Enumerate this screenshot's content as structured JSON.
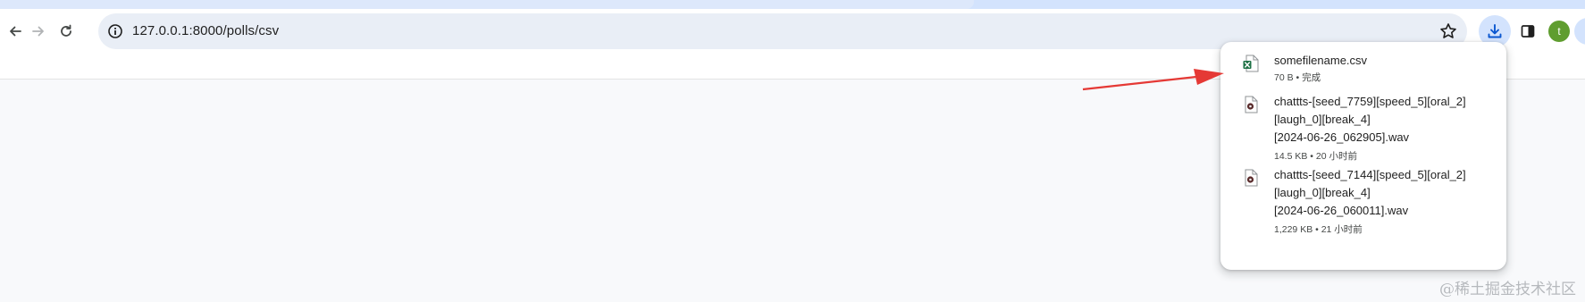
{
  "browser": {
    "url": "127.0.0.1:8000/polls/csv",
    "avatar_letter": "t"
  },
  "colors": {
    "accent": "#0b57d0",
    "toolbar_bg": "#ffffff",
    "omnibox_bg": "#e9eef6",
    "arrow": "#e53935",
    "excel_green": "#1e7145"
  },
  "downloads": {
    "items": [
      {
        "name": "somefilename.csv",
        "meta": "70 B • 完成",
        "icon": "excel-file-icon"
      },
      {
        "name": "chattts-[seed_7759][speed_5][oral_2][laugh_0][break_4][2024-06-26_062905].wav",
        "line1": "chattts-[seed_7759][speed_5][oral_2]",
        "line2": "[laugh_0][break_4]",
        "line3": "[2024-06-26_062905].wav",
        "meta": "14.5 KB • 20 小时前",
        "icon": "audio-file-icon"
      },
      {
        "name": "chattts-[seed_7144][speed_5][oral_2][laugh_0][break_4][2024-06-26_060011].wav",
        "line1": "chattts-[seed_7144][speed_5][oral_2]",
        "line2": "[laugh_0][break_4]",
        "line3": "[2024-06-26_060011].wav",
        "meta": "1,229 KB • 21 小时前",
        "icon": "audio-file-icon"
      }
    ]
  },
  "watermark": "@稀土掘金技术社区"
}
